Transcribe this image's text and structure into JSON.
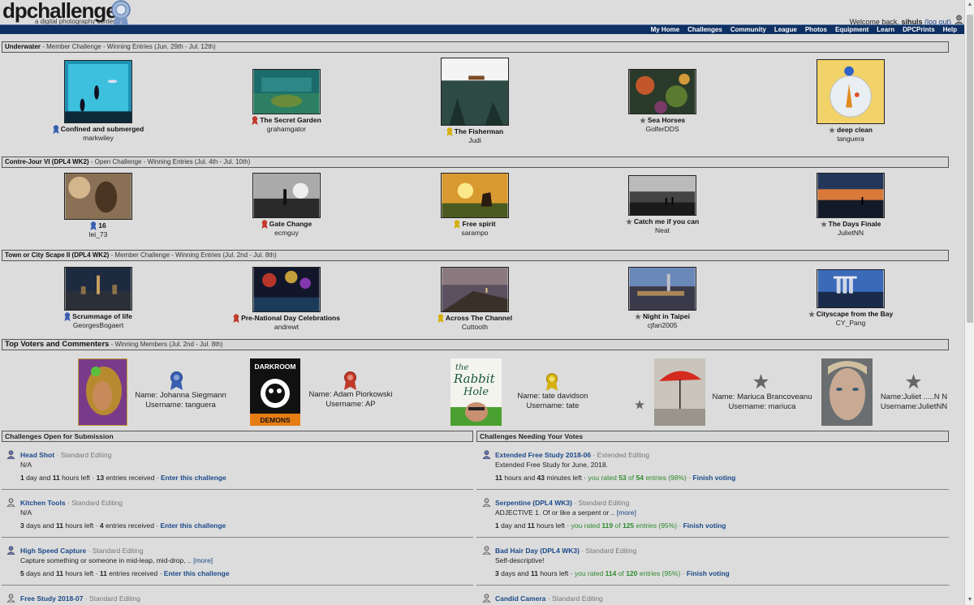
{
  "header": {
    "logo": "dpchallenge",
    "tagline": "a digital photography contest",
    "welcome": "Welcome back,",
    "username": "sjhuls",
    "logout": "(log out)"
  },
  "nav": [
    "My Home",
    "Challenges",
    "Community",
    "League",
    "Photos",
    "Equipment",
    "Learn",
    "DPCPrints",
    "Help"
  ],
  "sections": [
    {
      "title": "Underwater",
      "desc": " - Member Challenge - Winning Entries (Jun. 29th - Jul. 12th)",
      "entries": [
        {
          "title": "Confined and submerged",
          "user": "markwiley",
          "award": "blue"
        },
        {
          "title": "The Secret Garden",
          "user": "grahamgator",
          "award": "red"
        },
        {
          "title": "The Fisherman",
          "user": "Judi",
          "award": "yellow"
        },
        {
          "title": "Sea Horses",
          "user": "GolferDDS",
          "award": "star"
        },
        {
          "title": "deep clean",
          "user": "tanguera",
          "award": "star"
        }
      ]
    },
    {
      "title": "Contre-Jour VI (DPL4 WK2)",
      "desc": " - Open Challenge - Winning Entries (Jul. 4th - Jul. 10th)",
      "entries": [
        {
          "title": "16",
          "user": "lei_73",
          "award": "blue"
        },
        {
          "title": "Gate Change",
          "user": "ecmguy",
          "award": "red"
        },
        {
          "title": "Free spirit",
          "user": "sarampo",
          "award": "yellow"
        },
        {
          "title": "Catch me if you can",
          "user": "Neat",
          "award": "star"
        },
        {
          "title": "The Days Finale",
          "user": "JulietNN",
          "award": "star"
        }
      ]
    },
    {
      "title": "Town or City Scape II (DPL4 WK2)",
      "desc": " - Member Challenge - Winning Entries (Jul. 2nd - Jul. 8th)",
      "entries": [
        {
          "title": "Scrummage of life",
          "user": "GeorgesBogaert",
          "award": "blue"
        },
        {
          "title": "Pre-National Day Celebrations",
          "user": "andrewt",
          "award": "red"
        },
        {
          "title": "Across The Channel",
          "user": "Cuttooth",
          "award": "yellow"
        },
        {
          "title": "Night in Taipei",
          "user": "cjfan2005",
          "award": "star"
        },
        {
          "title": "Cityscape from the Bay",
          "user": "CY_Pang",
          "award": "star"
        }
      ]
    }
  ],
  "voters": {
    "title": "Top Voters and Commenters",
    "desc": " - Winning Members  (Jul. 2nd - Jul. 8th)",
    "items": [
      {
        "name": "Name: Johanna Siegmann",
        "username": "Username: tanguera"
      },
      {
        "name": "Name: Adam Piorkowski",
        "username": "Username: AP"
      },
      {
        "name": "Name: tate davidson",
        "username": "Username: tate"
      },
      {
        "name": "Name: Mariuca Brancoveanu",
        "username": "Username: mariuca"
      },
      {
        "name": "Name:Juliet .....N N",
        "username": "Username:JulietNN"
      }
    ],
    "darkroom_top": "DARKROOM",
    "darkroom_bottom": "DEMONS",
    "rabbit": [
      "the",
      "Rabbit",
      "Hole"
    ]
  },
  "open_header": "Challenges Open for Submission",
  "votes_header": "Challenges Needing Your Votes",
  "open": [
    {
      "name": "Head Shot",
      "cat": " · Standard Editing",
      "desc": "N/A",
      "more": "",
      "days": "1",
      "d1": " day and ",
      "hours": "11",
      "h1": " hours left · ",
      "entries": "13",
      "e1": " entries received · ",
      "action": "Enter this challenge"
    },
    {
      "name": "Kitchen Tools",
      "cat": " · Standard Editing",
      "desc": "N/A",
      "more": "",
      "days": "3",
      "d1": " days and ",
      "hours": "11",
      "h1": " hours left · ",
      "entries": "4",
      "e1": " entries received · ",
      "action": "Enter this challenge"
    },
    {
      "name": "High Speed Capture",
      "cat": " · Standard Editing",
      "desc": "Capture something or someone in mid-leap, mid-drop, .. ",
      "more": "[more]",
      "days": "5",
      "d1": " days and ",
      "hours": "11",
      "h1": " hours left · ",
      "entries": "11",
      "e1": " entries received · ",
      "action": "Enter this challenge"
    },
    {
      "name": "Free Study 2018-07",
      "cat": " · Standard Editing",
      "desc": "",
      "more": "",
      "days": "",
      "d1": "",
      "hours": "",
      "h1": "",
      "entries": "",
      "e1": "",
      "action": ""
    }
  ],
  "votes": [
    {
      "name": "Extended Free Study 2018-06",
      "cat": " · Extended Editing",
      "desc": "Extended Free Study for June, 2018.",
      "more": "",
      "t1": "11",
      "t1s": " hours and ",
      "t2": "43",
      "t2s": " minutes left · ",
      "rated": " you rated ",
      "n1": "53",
      "of": " of ",
      "n2": "54",
      "pct": " entries (98%) · ",
      "action": "Finish voting"
    },
    {
      "name": "Serpentine (DPL4 WK3)",
      "cat": " · Standard Editing",
      "desc": "ADJECTIVE 1. Of or like a serpent or .. ",
      "more": "[more]",
      "t1": "1",
      "t1s": " day and ",
      "t2": "11",
      "t2s": " hours left · ",
      "rated": " you rated ",
      "n1": "119",
      "of": " of ",
      "n2": "125",
      "pct": " entries (95%) · ",
      "action": "Finish voting"
    },
    {
      "name": "Bad Hair Day (DPL4 WK3)",
      "cat": " · Standard Editing",
      "desc": "Self-descriptive!",
      "more": "",
      "t1": "3",
      "t1s": " days and ",
      "t2": "11",
      "t2s": " hours left · ",
      "rated": " you rated ",
      "n1": "114",
      "of": " of ",
      "n2": "120",
      "pct": " entries (95%) · ",
      "action": "Finish voting"
    },
    {
      "name": "Candid Camera",
      "cat": " · Standard Editing",
      "desc": "",
      "more": "",
      "t1": "",
      "t1s": "",
      "t2": "",
      "t2s": "",
      "rated": "",
      "n1": "",
      "of": "",
      "n2": "",
      "pct": "",
      "action": ""
    }
  ],
  "colors": {
    "navbar": "#0e3062",
    "link": "#1b4a8a",
    "voted": "#2e8b2e",
    "ribbon_blue": "#3a5fb0",
    "ribbon_red": "#c0392b",
    "ribbon_yellow": "#d4b010",
    "star": "#666666"
  }
}
